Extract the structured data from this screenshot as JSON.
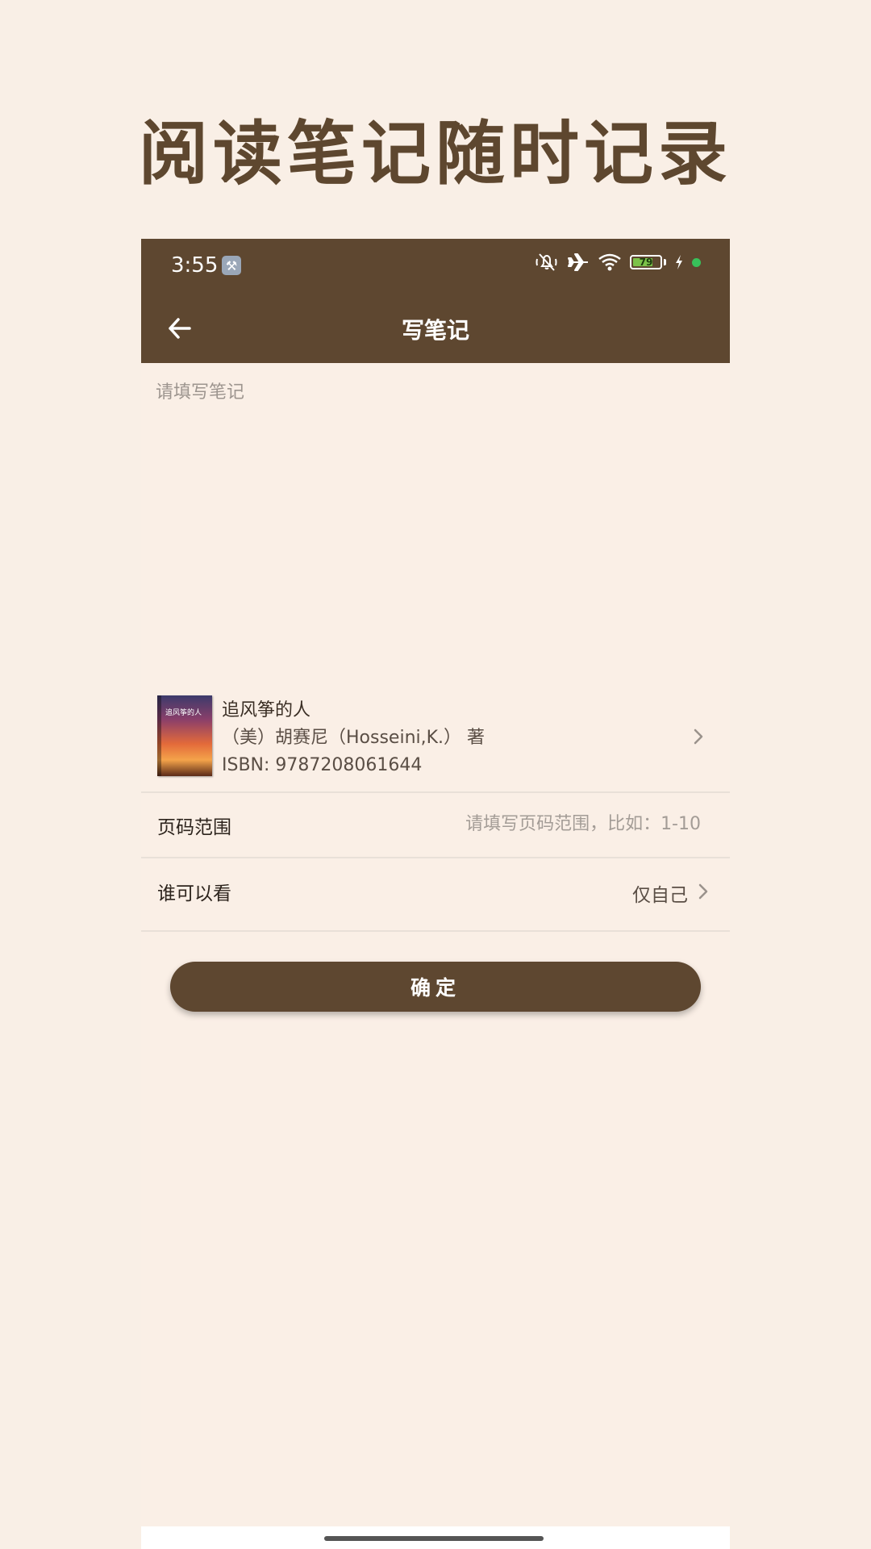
{
  "promo": {
    "title": "阅读笔记随时记录"
  },
  "status_bar": {
    "time": "3:55",
    "battery_level": "79",
    "battery_fraction": 0.79
  },
  "app_bar": {
    "title": "写笔记"
  },
  "note": {
    "placeholder": "请填写笔记",
    "value": ""
  },
  "book": {
    "title": "追风筝的人",
    "author": "（美）胡赛尼（Hosseini,K.） 著",
    "isbn": "ISBN: 9787208061644",
    "cover_text": "追风筝的人"
  },
  "form": {
    "page_range": {
      "label": "页码范围",
      "placeholder": "请填写页码范围，比如：1-10",
      "value": ""
    },
    "visibility": {
      "label": "谁可以看",
      "value": "仅自己"
    }
  },
  "confirm_button": {
    "label": "确定"
  },
  "colors": {
    "brand": "#5e4730",
    "background": "#faefe6",
    "accent_green": "#38c15a"
  },
  "icons": [
    "wrench-icon",
    "mute-icon",
    "airplane-icon",
    "wifi-icon",
    "battery-icon",
    "charging-icon",
    "back-arrow-icon",
    "chevron-right-icon"
  ]
}
